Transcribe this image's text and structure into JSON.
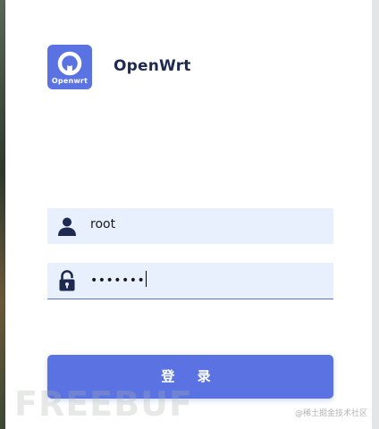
{
  "brand": {
    "logo_caption": "Openwrt",
    "title": "OpenWrt",
    "accent_color": "#5b73e2",
    "title_color": "#1e2a4f"
  },
  "login_form": {
    "username": {
      "icon": "user-icon",
      "value": "root"
    },
    "password": {
      "icon": "unlock-icon",
      "masked_value": "•••••••"
    },
    "submit_label": "登 录"
  },
  "watermark": {
    "logo_text": "FREEBUF",
    "credit_text": "@稀土掘金技术社区"
  }
}
